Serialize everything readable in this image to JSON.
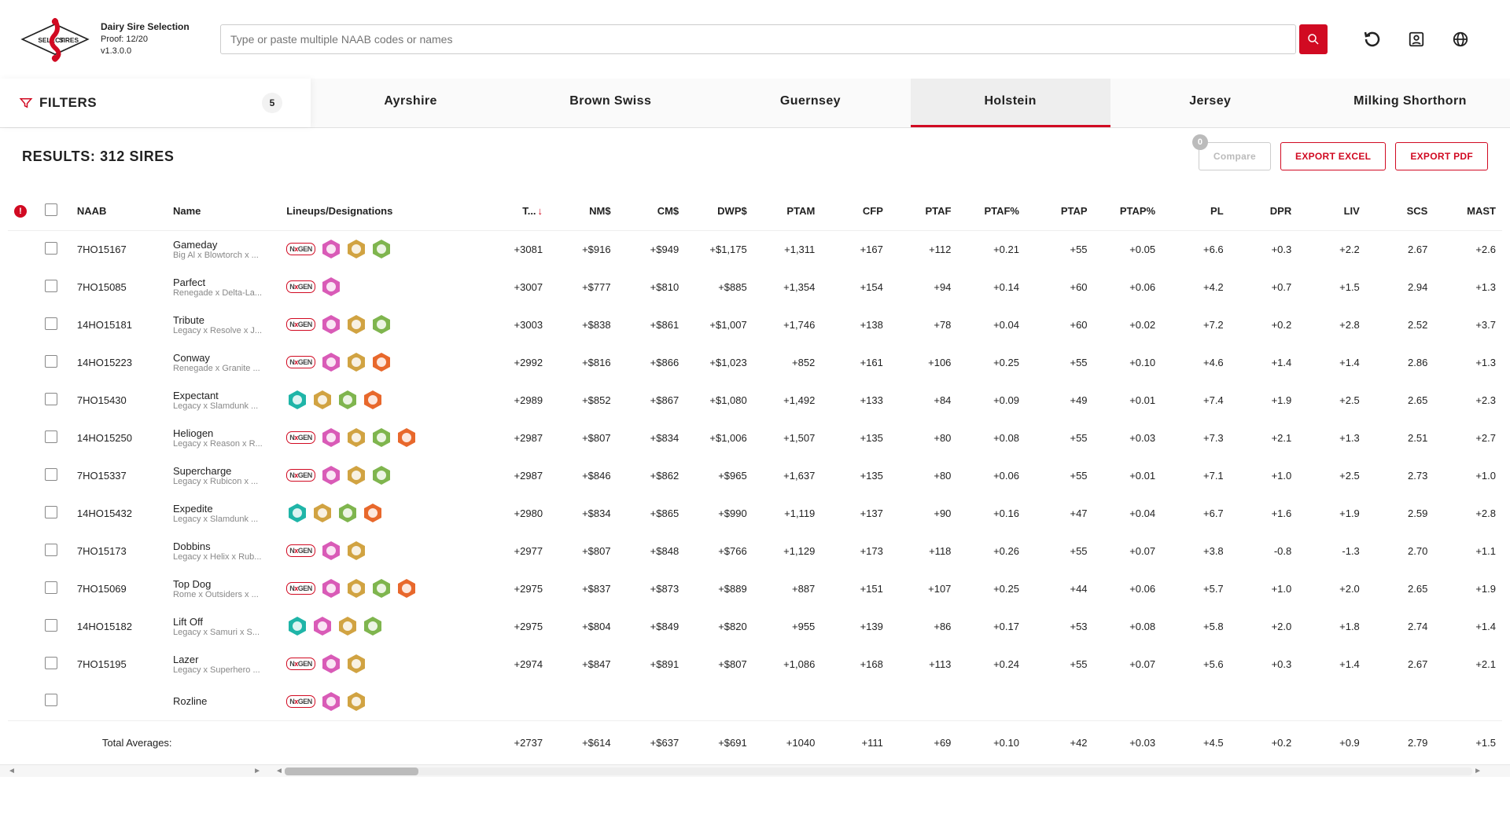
{
  "app": {
    "title": "Dairy Sire Selection",
    "proof": "Proof: 12/20",
    "version": "v1.3.0.0"
  },
  "search": {
    "placeholder": "Type or paste multiple NAAB codes or names"
  },
  "filters": {
    "label": "FILTERS",
    "count": "5"
  },
  "tabs": [
    {
      "label": "Ayrshire",
      "active": false
    },
    {
      "label": "Brown Swiss",
      "active": false
    },
    {
      "label": "Guernsey",
      "active": false
    },
    {
      "label": "Holstein",
      "active": true
    },
    {
      "label": "Jersey",
      "active": false
    },
    {
      "label": "Milking Shorthorn",
      "active": false
    }
  ],
  "results_label": "RESULTS: 312 SIRES",
  "toolbar": {
    "compare": "Compare",
    "compare_count": "0",
    "export_excel": "EXPORT EXCEL",
    "export_pdf": "EXPORT PDF"
  },
  "columns": [
    "NAAB",
    "Name",
    "Lineups/Designations",
    "T...",
    "NM$",
    "CM$",
    "DWP$",
    "PTAM",
    "CFP",
    "PTAF",
    "PTAF%",
    "PTAP",
    "PTAP%",
    "PL",
    "DPR",
    "LIV",
    "SCS",
    "MAST"
  ],
  "sort_column_index": 3,
  "footer_label": "Total Averages:",
  "footer_values": [
    "+2737",
    "+$614",
    "+$637",
    "+$691",
    "+1040",
    "+111",
    "+69",
    "+0.10",
    "+42",
    "+0.03",
    "+4.5",
    "+0.2",
    "+0.9",
    "2.79",
    "+1.5"
  ],
  "rows": [
    {
      "naab": "7HO15167",
      "name": "Gameday",
      "pedigree": "Big Al x Blowtorch x ...",
      "badges": [
        "nxgen",
        "pink",
        "tan",
        "green"
      ],
      "vals": [
        "+3081",
        "+$916",
        "+$949",
        "+$1,175",
        "+1,311",
        "+167",
        "+112",
        "+0.21",
        "+55",
        "+0.05",
        "+6.6",
        "+0.3",
        "+2.2",
        "2.67",
        "+2.6"
      ]
    },
    {
      "naab": "7HO15085",
      "name": "Parfect",
      "pedigree": "Renegade x Delta-La...",
      "badges": [
        "nxgen",
        "pink"
      ],
      "vals": [
        "+3007",
        "+$777",
        "+$810",
        "+$885",
        "+1,354",
        "+154",
        "+94",
        "+0.14",
        "+60",
        "+0.06",
        "+4.2",
        "+0.7",
        "+1.5",
        "2.94",
        "+1.3"
      ]
    },
    {
      "naab": "14HO15181",
      "name": "Tribute",
      "pedigree": "Legacy x Resolve x J...",
      "badges": [
        "nxgen",
        "pink",
        "tan",
        "green"
      ],
      "vals": [
        "+3003",
        "+$838",
        "+$861",
        "+$1,007",
        "+1,746",
        "+138",
        "+78",
        "+0.04",
        "+60",
        "+0.02",
        "+7.2",
        "+0.2",
        "+2.8",
        "2.52",
        "+3.7"
      ]
    },
    {
      "naab": "14HO15223",
      "name": "Conway",
      "pedigree": "Renegade x Granite ...",
      "badges": [
        "nxgen",
        "pink",
        "tan",
        "orange"
      ],
      "vals": [
        "+2992",
        "+$816",
        "+$866",
        "+$1,023",
        "+852",
        "+161",
        "+106",
        "+0.25",
        "+55",
        "+0.10",
        "+4.6",
        "+1.4",
        "+1.4",
        "2.86",
        "+1.3"
      ]
    },
    {
      "naab": "7HO15430",
      "name": "Expectant",
      "pedigree": "Legacy x Slamdunk ...",
      "badges": [
        "teal",
        "tan",
        "green",
        "orange"
      ],
      "vals": [
        "+2989",
        "+$852",
        "+$867",
        "+$1,080",
        "+1,492",
        "+133",
        "+84",
        "+0.09",
        "+49",
        "+0.01",
        "+7.4",
        "+1.9",
        "+2.5",
        "2.65",
        "+2.3"
      ]
    },
    {
      "naab": "14HO15250",
      "name": "Heliogen",
      "pedigree": "Legacy x Reason x R...",
      "badges": [
        "nxgen",
        "pink",
        "tan",
        "green",
        "orange"
      ],
      "vals": [
        "+2987",
        "+$807",
        "+$834",
        "+$1,006",
        "+1,507",
        "+135",
        "+80",
        "+0.08",
        "+55",
        "+0.03",
        "+7.3",
        "+2.1",
        "+1.3",
        "2.51",
        "+2.7"
      ]
    },
    {
      "naab": "7HO15337",
      "name": "Supercharge",
      "pedigree": "Legacy x Rubicon x ...",
      "badges": [
        "nxgen",
        "pink",
        "tan",
        "green"
      ],
      "vals": [
        "+2987",
        "+$846",
        "+$862",
        "+$965",
        "+1,637",
        "+135",
        "+80",
        "+0.06",
        "+55",
        "+0.01",
        "+7.1",
        "+1.0",
        "+2.5",
        "2.73",
        "+1.0"
      ]
    },
    {
      "naab": "14HO15432",
      "name": "Expedite",
      "pedigree": "Legacy x Slamdunk ...",
      "badges": [
        "teal",
        "tan",
        "green",
        "orange"
      ],
      "vals": [
        "+2980",
        "+$834",
        "+$865",
        "+$990",
        "+1,119",
        "+137",
        "+90",
        "+0.16",
        "+47",
        "+0.04",
        "+6.7",
        "+1.6",
        "+1.9",
        "2.59",
        "+2.8"
      ]
    },
    {
      "naab": "7HO15173",
      "name": "Dobbins",
      "pedigree": "Legacy x Helix x Rub...",
      "badges": [
        "nxgen",
        "pink",
        "tan"
      ],
      "vals": [
        "+2977",
        "+$807",
        "+$848",
        "+$766",
        "+1,129",
        "+173",
        "+118",
        "+0.26",
        "+55",
        "+0.07",
        "+3.8",
        "-0.8",
        "-1.3",
        "2.70",
        "+1.1"
      ]
    },
    {
      "naab": "7HO15069",
      "name": "Top Dog",
      "pedigree": "Rome x Outsiders x ...",
      "badges": [
        "nxgen",
        "pink",
        "tan",
        "green",
        "orange"
      ],
      "vals": [
        "+2975",
        "+$837",
        "+$873",
        "+$889",
        "+887",
        "+151",
        "+107",
        "+0.25",
        "+44",
        "+0.06",
        "+5.7",
        "+1.0",
        "+2.0",
        "2.65",
        "+1.9"
      ]
    },
    {
      "naab": "14HO15182",
      "name": "Lift Off",
      "pedigree": "Legacy x Samuri x S...",
      "badges": [
        "teal",
        "pink",
        "tan",
        "green"
      ],
      "vals": [
        "+2975",
        "+$804",
        "+$849",
        "+$820",
        "+955",
        "+139",
        "+86",
        "+0.17",
        "+53",
        "+0.08",
        "+5.8",
        "+2.0",
        "+1.8",
        "2.74",
        "+1.4"
      ]
    },
    {
      "naab": "7HO15195",
      "name": "Lazer",
      "pedigree": "Legacy x Superhero ...",
      "badges": [
        "nxgen",
        "pink",
        "tan"
      ],
      "vals": [
        "+2974",
        "+$847",
        "+$891",
        "+$807",
        "+1,086",
        "+168",
        "+113",
        "+0.24",
        "+55",
        "+0.07",
        "+5.6",
        "+0.3",
        "+1.4",
        "2.67",
        "+2.1"
      ]
    },
    {
      "naab": "",
      "name": "Rozline",
      "pedigree": "",
      "badges": [
        "nxgen",
        "pink",
        "tan"
      ],
      "vals": [
        "",
        "",
        "",
        "",
        "",
        "",
        "",
        "",
        "",
        "",
        "",
        "",
        "",
        "",
        ""
      ]
    }
  ]
}
